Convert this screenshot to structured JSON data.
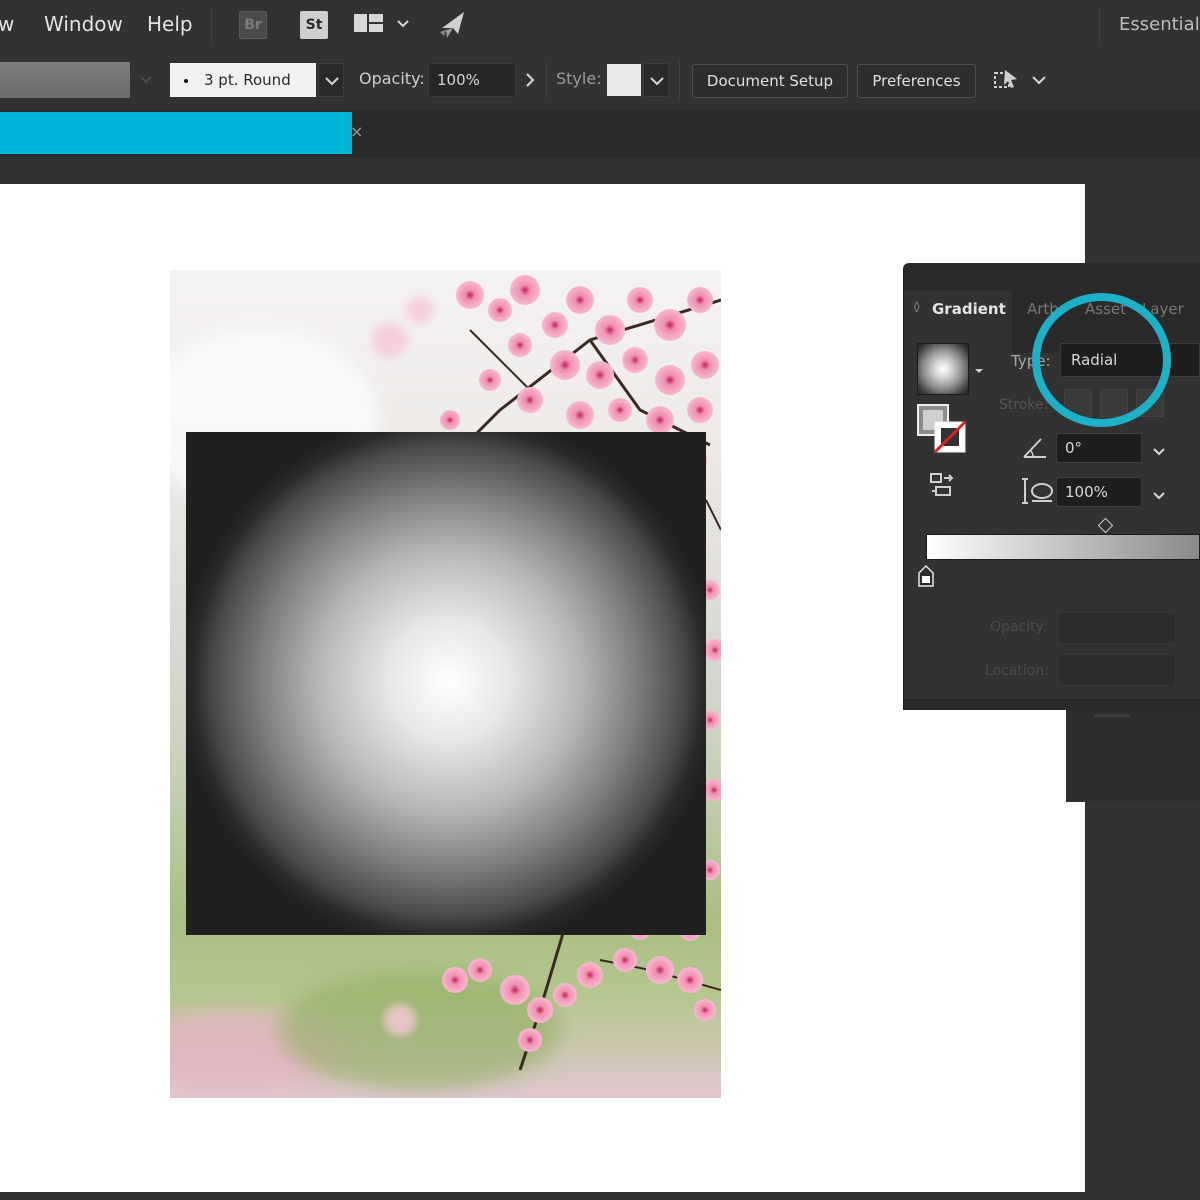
{
  "menubar": {
    "items": [
      {
        "label": "w"
      },
      {
        "label": "Window"
      },
      {
        "label": "Help"
      }
    ],
    "bridge_label": "Br",
    "stock_label": "St",
    "workspace_label": "Essentials"
  },
  "control_bar": {
    "brush_value": "3 pt. Round",
    "opacity_label": "Opacity:",
    "opacity_value": "100%",
    "style_label": "Style:",
    "document_setup_label": "Document Setup",
    "preferences_label": "Preferences"
  },
  "document_tab": {
    "close_glyph": "×",
    "accent_color": "#00b4d8"
  },
  "gradient_panel": {
    "tabs": [
      {
        "label": "Gradient",
        "active": true
      },
      {
        "label": "Artb",
        "active": false
      },
      {
        "label": "Asset",
        "active": false
      },
      {
        "label": "Layer",
        "active": false
      }
    ],
    "type_label": "Type:",
    "type_value": "Radial",
    "stroke_label": "Stroke:",
    "angle_value": "0°",
    "aspect_ratio_value": "100%",
    "opacity_label": "Opacity:",
    "location_label": "Location:"
  },
  "highlight": {
    "color": "#1fb0c9",
    "target": "type-select"
  },
  "icons": {
    "bridge": "bridge-icon",
    "stock": "stock-icon",
    "workspace": "arrange-documents-icon",
    "gpu": "rocket-icon",
    "isolate": "isolate-icon",
    "gradient_preview": "gradient-swatch-icon",
    "fill_stroke": "fill-stroke-icon",
    "reverse": "reverse-gradient-icon",
    "angle": "angle-icon",
    "aspect": "aspect-ratio-icon",
    "color_stop": "color-stop-icon"
  }
}
